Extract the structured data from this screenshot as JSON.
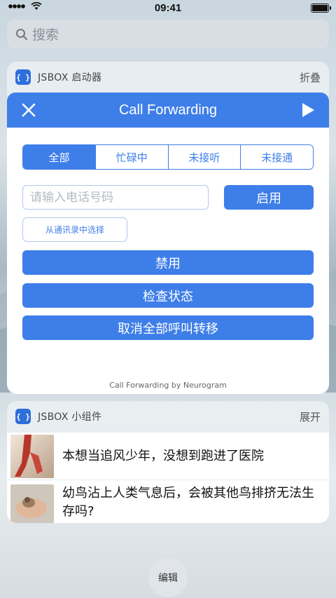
{
  "status": {
    "time": "09:41"
  },
  "search": {
    "placeholder": "搜索"
  },
  "launcher": {
    "icon_text": "{ }",
    "title": "JSBOX 启动器",
    "action": "折叠"
  },
  "call_forwarding": {
    "title": "Call Forwarding",
    "tabs": [
      {
        "label": "全部",
        "active": true
      },
      {
        "label": "忙碌中",
        "active": false
      },
      {
        "label": "未接听",
        "active": false
      },
      {
        "label": "未接通",
        "active": false
      }
    ],
    "phone_placeholder": "请输入电话号码",
    "enable_label": "启用",
    "contacts_label": "从通讯录中选择",
    "disable_label": "禁用",
    "check_label": "检查状态",
    "cancel_all_label": "取消全部呼叫转移",
    "footer": "Call Forwarding by Neurogram",
    "accent_color": "#3e7ee8"
  },
  "widget": {
    "icon_text": "{ }",
    "title": "JSBOX 小组件",
    "action": "展开",
    "news": [
      {
        "title": "本想当追风少年，没想到跑进了医院"
      },
      {
        "title": "幼鸟沾上人类气息后，会被其他鸟排挤无法生存吗?"
      }
    ]
  },
  "edit_label": "编辑"
}
